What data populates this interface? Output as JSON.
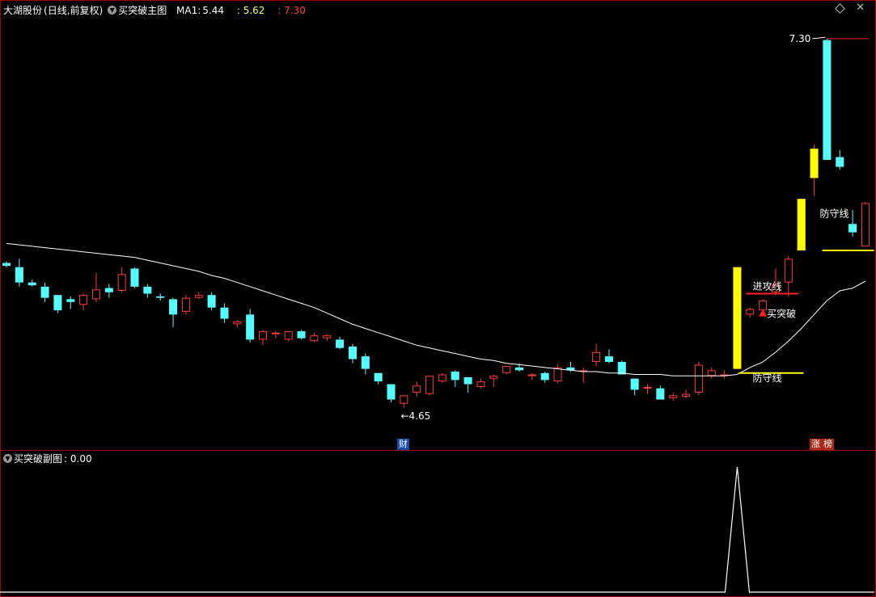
{
  "header": {
    "stock_name": "大湖股份",
    "period": "(日线,前复权)",
    "indicator_name": "买突破主图",
    "ma_label": "MA1:",
    "ma_value": "5.44",
    "value2": ": 5.62",
    "value3": ": 7.30"
  },
  "sub_header": {
    "indicator_name": "买突破副图",
    "value": ": 0.00"
  },
  "colors": {
    "up": "#ff3a3a",
    "down": "#54ffff",
    "ma_line": "#ffffff",
    "signal_bar": "#ffff00",
    "defense_line": "#ffff00",
    "attack_line": "#ff2020",
    "value2_text": "#ffff66",
    "value3_text": "#ff4040",
    "border": "#a00000"
  },
  "annotations": {
    "high_label": "7.30",
    "low_label": "4.65",
    "attack_line_label": "进攻线",
    "defense_line_label_1": "防守线",
    "defense_line_label_2": "防守线",
    "buy_signal_label": "买突破"
  },
  "markers": {
    "finance": "财",
    "limit_up": "涨",
    "list": "榜"
  },
  "icons": {
    "dropdown": "chevron-down-icon",
    "window": "diamond-icon",
    "close": "close-icon",
    "buy_signal": "triangle-up-icon"
  },
  "chart_data": [
    {
      "type": "candlestick",
      "title": "大湖股份 (日线,前复权)",
      "ylim": [
        4.4,
        7.45
      ],
      "series": [
        {
          "name": "K线",
          "ohlc": [
            [
              5.69,
              5.7,
              5.66,
              5.67
            ],
            [
              5.66,
              5.72,
              5.52,
              5.55
            ],
            [
              5.55,
              5.57,
              5.52,
              5.53
            ],
            [
              5.52,
              5.55,
              5.41,
              5.44
            ],
            [
              5.46,
              5.46,
              5.33,
              5.35
            ],
            [
              5.43,
              5.45,
              5.36,
              5.41
            ],
            [
              5.39,
              5.47,
              5.35,
              5.46
            ],
            [
              5.43,
              5.62,
              5.41,
              5.5
            ],
            [
              5.51,
              5.54,
              5.44,
              5.48
            ],
            [
              5.49,
              5.66,
              5.48,
              5.61
            ],
            [
              5.65,
              5.66,
              5.51,
              5.52
            ],
            [
              5.52,
              5.54,
              5.44,
              5.47
            ],
            [
              5.45,
              5.47,
              5.42,
              5.44
            ],
            [
              5.43,
              5.44,
              5.23,
              5.32
            ],
            [
              5.34,
              5.46,
              5.32,
              5.44
            ],
            [
              5.44,
              5.48,
              5.43,
              5.46
            ],
            [
              5.46,
              5.48,
              5.35,
              5.37
            ],
            [
              5.37,
              5.4,
              5.26,
              5.29
            ],
            [
              5.25,
              5.28,
              5.23,
              5.27
            ],
            [
              5.32,
              5.36,
              5.12,
              5.14
            ],
            [
              5.14,
              5.21,
              5.1,
              5.2
            ],
            [
              5.18,
              5.2,
              5.15,
              5.19
            ],
            [
              5.14,
              5.2,
              5.13,
              5.2
            ],
            [
              5.2,
              5.21,
              5.14,
              5.15
            ],
            [
              5.13,
              5.19,
              5.12,
              5.17
            ],
            [
              5.15,
              5.18,
              5.13,
              5.17
            ],
            [
              5.14,
              5.16,
              5.07,
              5.08
            ],
            [
              5.09,
              5.11,
              4.97,
              5.0
            ],
            [
              5.02,
              5.04,
              4.89,
              4.93
            ],
            [
              4.9,
              4.9,
              4.82,
              4.84
            ],
            [
              4.82,
              4.82,
              4.69,
              4.71
            ],
            [
              4.68,
              4.74,
              4.65,
              4.74
            ],
            [
              4.76,
              4.84,
              4.73,
              4.81
            ],
            [
              4.75,
              4.88,
              4.74,
              4.88
            ],
            [
              4.84,
              4.9,
              4.83,
              4.89
            ],
            [
              4.91,
              4.92,
              4.8,
              4.85
            ],
            [
              4.87,
              4.87,
              4.76,
              4.82
            ],
            [
              4.8,
              4.86,
              4.79,
              4.84
            ],
            [
              4.86,
              4.89,
              4.8,
              4.88
            ],
            [
              4.9,
              4.95,
              4.89,
              4.95
            ],
            [
              4.94,
              4.97,
              4.91,
              4.92
            ],
            [
              4.88,
              4.9,
              4.85,
              4.89
            ],
            [
              4.9,
              4.91,
              4.83,
              4.85
            ],
            [
              4.84,
              4.96,
              4.83,
              4.94
            ],
            [
              4.94,
              4.98,
              4.91,
              4.92
            ],
            [
              4.92,
              4.94,
              4.83,
              4.92
            ],
            [
              4.98,
              5.11,
              4.95,
              5.05
            ],
            [
              5.02,
              5.07,
              4.97,
              4.98
            ],
            [
              4.98,
              4.99,
              4.89,
              4.89
            ],
            [
              4.86,
              4.86,
              4.74,
              4.78
            ],
            [
              4.79,
              4.82,
              4.75,
              4.8
            ],
            [
              4.79,
              4.81,
              4.71,
              4.71
            ],
            [
              4.72,
              4.76,
              4.7,
              4.74
            ],
            [
              4.73,
              4.78,
              4.72,
              4.75
            ],
            [
              4.76,
              4.98,
              4.74,
              4.96
            ],
            [
              4.88,
              4.94,
              4.86,
              4.92
            ],
            [
              4.89,
              4.92,
              4.86,
              4.89
            ],
            [
              4.93,
              5.66,
              4.93,
              5.66
            ],
            [
              5.32,
              5.37,
              5.3,
              5.36
            ],
            [
              5.35,
              5.43,
              5.33,
              5.42
            ],
            [
              5.48,
              5.65,
              5.46,
              5.53
            ],
            [
              5.55,
              5.74,
              5.45,
              5.72
            ],
            [
              5.78,
              5.87,
              5.78,
              6.15
            ],
            [
              6.3,
              6.54,
              6.17,
              6.51
            ],
            [
              7.29,
              7.3,
              6.43,
              6.43
            ],
            [
              6.45,
              6.5,
              6.36,
              6.38
            ],
            [
              5.97,
              6.07,
              5.88,
              5.91
            ],
            [
              5.81,
              6.13,
              5.83,
              6.12
            ]
          ]
        },
        {
          "name": "MA1",
          "values": [
            5.83,
            5.82,
            5.81,
            5.8,
            5.79,
            5.78,
            5.77,
            5.76,
            5.75,
            5.74,
            5.73,
            5.71,
            5.69,
            5.67,
            5.65,
            5.63,
            5.6,
            5.58,
            5.55,
            5.52,
            5.49,
            5.46,
            5.43,
            5.4,
            5.37,
            5.33,
            5.29,
            5.25,
            5.22,
            5.19,
            5.16,
            5.13,
            5.1,
            5.08,
            5.06,
            5.04,
            5.02,
            5.0,
            4.99,
            4.97,
            4.96,
            4.95,
            4.94,
            4.93,
            4.92,
            4.91,
            4.91,
            4.9,
            4.9,
            4.89,
            4.89,
            4.89,
            4.88,
            4.88,
            4.88,
            4.88,
            4.88,
            4.89,
            4.94,
            4.98,
            5.05,
            5.13,
            5.22,
            5.32,
            5.42,
            5.49,
            5.51,
            5.56
          ]
        }
      ]
    },
    {
      "type": "line",
      "title": "买突破副图",
      "ylim": [
        0,
        1
      ],
      "series": [
        {
          "name": "买突破副图",
          "peak_index": 57,
          "peak_value": 1
        }
      ]
    }
  ]
}
